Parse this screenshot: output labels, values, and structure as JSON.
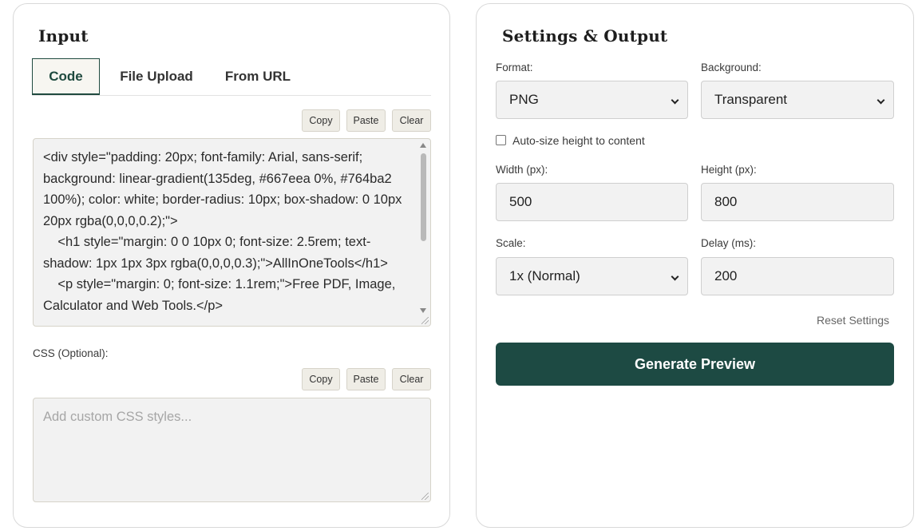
{
  "input_panel": {
    "title": "Input",
    "tabs": [
      {
        "label": "Code",
        "active": true
      },
      {
        "label": "File Upload",
        "active": false
      },
      {
        "label": "From URL",
        "active": false
      }
    ],
    "code_actions": {
      "copy": "Copy",
      "paste": "Paste",
      "clear": "Clear"
    },
    "code_value": "<div style=\"padding: 20px; font-family: Arial, sans-serif; background: linear-gradient(135deg, #667eea 0%, #764ba2 100%); color: white; border-radius: 10px; box-shadow: 0 10px 20px rgba(0,0,0,0.2);\">\n    <h1 style=\"margin: 0 0 10px 0; font-size: 2.5rem; text-shadow: 1px 1px 3px rgba(0,0,0,0.3);\">AllInOneTools</h1>\n    <p style=\"margin: 0; font-size: 1.1rem;\">Free PDF, Image, Calculator and Web Tools.</p>",
    "css_label": "CSS (Optional):",
    "css_actions": {
      "copy": "Copy",
      "paste": "Paste",
      "clear": "Clear"
    },
    "css_placeholder": "Add custom CSS styles..."
  },
  "settings_panel": {
    "title": "Settings & Output",
    "format_label": "Format:",
    "format_value": "PNG",
    "background_label": "Background:",
    "background_value": "Transparent",
    "autosize_label": "Auto-size height to content",
    "autosize_checked": false,
    "width_label": "Width (px):",
    "width_value": "500",
    "height_label": "Height (px):",
    "height_value": "800",
    "scale_label": "Scale:",
    "scale_value": "1x (Normal)",
    "delay_label": "Delay (ms):",
    "delay_value": "200",
    "reset_label": "Reset Settings",
    "generate_label": "Generate Preview"
  },
  "colors": {
    "accent": "#1d4a43",
    "tab_active_border": "#1f4a3f",
    "field_bg": "#f2f2f2",
    "button_bg": "#efede6"
  }
}
